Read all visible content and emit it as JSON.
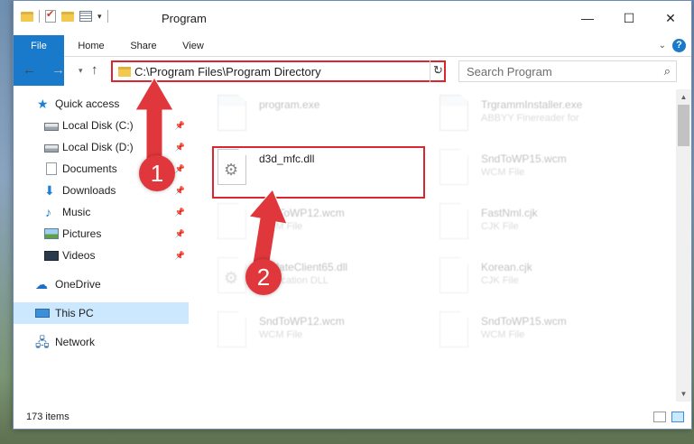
{
  "window": {
    "title": "Program",
    "controls": {
      "minimize": "—",
      "maximize": "☐",
      "close": "✕"
    }
  },
  "ribbon": {
    "tabs": [
      "File",
      "Home",
      "Share",
      "View"
    ],
    "collapse_icon": "chevron-down-icon",
    "help_label": "?"
  },
  "navigation": {
    "back": "←",
    "forward": "→",
    "recent": "▾",
    "up": "↑",
    "address_path": "C:\\Program Files\\Program Directory",
    "address_dropdown": "⌄",
    "refresh": "↻",
    "search_placeholder": "Search Program",
    "search_icon": "⌕"
  },
  "sidebar": {
    "items": [
      {
        "label": "Quick access",
        "icon": "star-icon",
        "pinned": false
      },
      {
        "label": "Local Disk (C:)",
        "icon": "disk-icon",
        "pinned": true
      },
      {
        "label": "Local Disk (D:)",
        "icon": "disk-icon",
        "pinned": true
      },
      {
        "label": "Documents",
        "icon": "documents-icon",
        "pinned": true
      },
      {
        "label": "Downloads",
        "icon": "download-icon",
        "pinned": true
      },
      {
        "label": "Music",
        "icon": "music-icon",
        "pinned": true
      },
      {
        "label": "Pictures",
        "icon": "pictures-icon",
        "pinned": true
      },
      {
        "label": "Videos",
        "icon": "videos-icon",
        "pinned": true
      },
      {
        "label": "OneDrive",
        "icon": "cloud-icon",
        "pinned": false
      },
      {
        "label": "This PC",
        "icon": "computer-icon",
        "pinned": false,
        "selected": true
      },
      {
        "label": "Network",
        "icon": "network-icon",
        "pinned": false
      }
    ],
    "pin_glyph": "📌"
  },
  "files": [
    {
      "name": "program.exe",
      "type": "",
      "kind": "exe",
      "faded": true
    },
    {
      "name": "TrgrammInstaller.exe",
      "type": "ABBYY Finereader for",
      "kind": "exe",
      "faded": true
    },
    {
      "name": "d3d_mfc.dll",
      "type": "",
      "kind": "dll",
      "faded": false,
      "highlighted": true
    },
    {
      "name": "SndToWP15.wcm",
      "type": "WCM File",
      "kind": "file",
      "faded": true
    },
    {
      "name": "SndToWP12.wcm",
      "type": "WCM File",
      "kind": "file",
      "faded": true
    },
    {
      "name": "FastNml.cjk",
      "type": "CJK File",
      "kind": "file",
      "faded": true
    },
    {
      "name": "UpdateClient65.dll",
      "type": "Application DLL",
      "kind": "dll",
      "faded": true
    },
    {
      "name": "Korean.cjk",
      "type": "CJK File",
      "kind": "file",
      "faded": true
    },
    {
      "name": "SndToWP12.wcm",
      "type": "WCM File",
      "kind": "file",
      "faded": true
    },
    {
      "name": "SndToWP15.wcm",
      "type": "WCM File",
      "kind": "file",
      "faded": true
    }
  ],
  "status": {
    "item_count": "173 items"
  },
  "annotations": {
    "step1": "1",
    "step2": "2",
    "color": "#d9262f"
  }
}
